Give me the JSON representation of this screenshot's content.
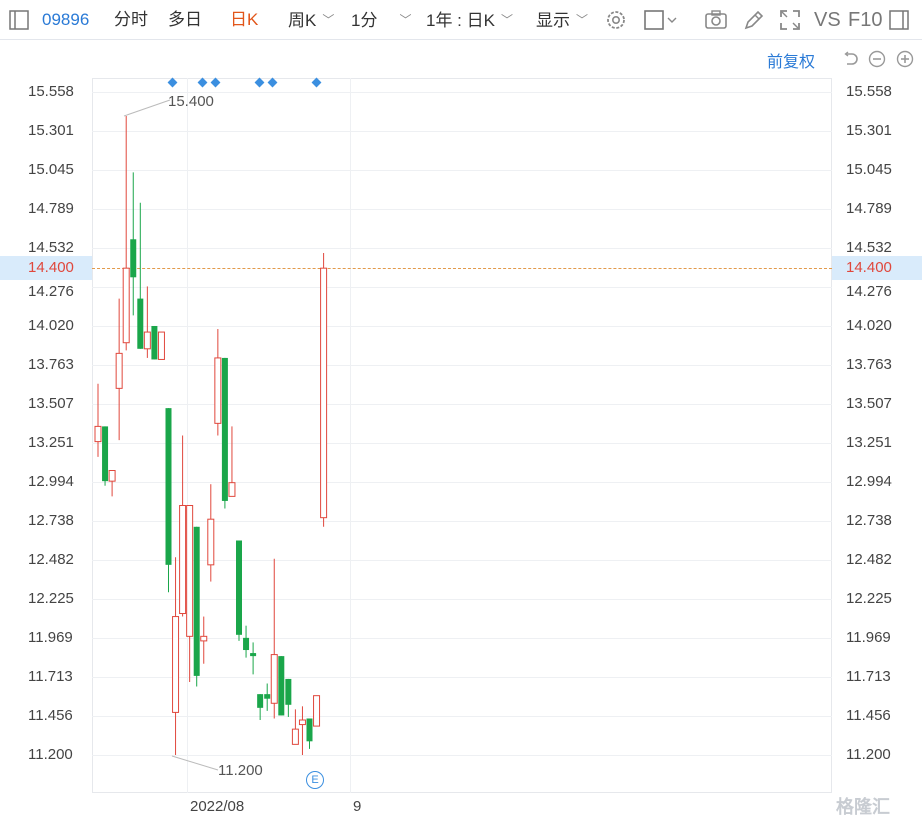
{
  "toolbar": {
    "code": "09896",
    "tab_intraday": "分时",
    "tab_multiday": "多日",
    "tab_daily": "日K",
    "tab_weekly": "周K",
    "tab_minute": "1分",
    "range": "1年 : 日K",
    "display": "显示",
    "vs": "VS",
    "f10": "F10"
  },
  "subbar": {
    "restore": "前复权"
  },
  "chart_data": {
    "type": "candlestick",
    "yticks": [
      "15.558",
      "15.301",
      "15.045",
      "14.789",
      "14.532",
      "14.276",
      "14.020",
      "13.763",
      "13.507",
      "13.251",
      "12.994",
      "12.738",
      "12.482",
      "12.225",
      "11.969",
      "11.713",
      "11.456",
      "11.200"
    ],
    "current_price": "14.400",
    "xlabels": [
      "2022/08",
      "9"
    ],
    "annotations": {
      "high": "15.400",
      "low": "11.200"
    },
    "event_marker": "E",
    "colors": {
      "up": "#e0473c",
      "down": "#1aa64a"
    },
    "candles": [
      {
        "o": 13.26,
        "c": 13.36,
        "h": 13.64,
        "l": 13.16
      },
      {
        "o": 13.36,
        "c": 13.0,
        "h": 13.36,
        "l": 12.97
      },
      {
        "o": 13.0,
        "c": 13.07,
        "h": 13.07,
        "l": 12.9
      },
      {
        "o": 13.61,
        "c": 13.84,
        "h": 14.2,
        "l": 13.27
      },
      {
        "o": 13.91,
        "c": 14.4,
        "h": 15.4,
        "l": 13.86
      },
      {
        "o": 14.59,
        "c": 14.34,
        "h": 15.03,
        "l": 14.09
      },
      {
        "o": 14.2,
        "c": 13.87,
        "h": 14.83,
        "l": 13.87
      },
      {
        "o": 13.87,
        "c": 13.98,
        "h": 14.28,
        "l": 13.81
      },
      {
        "o": 14.02,
        "c": 13.8,
        "h": 14.02,
        "l": 13.8
      },
      {
        "o": 13.8,
        "c": 13.98,
        "h": 13.98,
        "l": 13.8
      },
      {
        "o": 13.48,
        "c": 12.45,
        "h": 13.48,
        "l": 12.27
      },
      {
        "o": 11.48,
        "c": 12.11,
        "h": 12.5,
        "l": 11.2
      },
      {
        "o": 12.13,
        "c": 12.84,
        "h": 13.3,
        "l": 12.11
      },
      {
        "o": 11.98,
        "c": 12.84,
        "h": 12.84,
        "l": 11.68
      },
      {
        "o": 12.7,
        "c": 11.72,
        "h": 12.7,
        "l": 11.65
      },
      {
        "o": 11.95,
        "c": 11.98,
        "h": 12.11,
        "l": 11.8
      },
      {
        "o": 12.45,
        "c": 12.75,
        "h": 12.98,
        "l": 12.34
      },
      {
        "o": 13.38,
        "c": 13.81,
        "h": 14.0,
        "l": 13.3
      },
      {
        "o": 13.81,
        "c": 12.87,
        "h": 13.81,
        "l": 12.82
      },
      {
        "o": 12.9,
        "c": 12.99,
        "h": 13.36,
        "l": 12.9
      },
      {
        "o": 12.61,
        "c": 11.99,
        "h": 12.61,
        "l": 11.95
      },
      {
        "o": 11.97,
        "c": 11.89,
        "h": 12.05,
        "l": 11.84
      },
      {
        "o": 11.87,
        "c": 11.85,
        "h": 11.94,
        "l": 11.73
      },
      {
        "o": 11.6,
        "c": 11.51,
        "h": 11.6,
        "l": 11.43
      },
      {
        "o": 11.6,
        "c": 11.57,
        "h": 11.67,
        "l": 11.49
      },
      {
        "o": 11.54,
        "c": 11.86,
        "h": 12.49,
        "l": 11.44
      },
      {
        "o": 11.85,
        "c": 11.46,
        "h": 11.85,
        "l": 11.46
      },
      {
        "o": 11.7,
        "c": 11.53,
        "h": 11.7,
        "l": 11.45
      },
      {
        "o": 11.27,
        "c": 11.37,
        "h": 11.5,
        "l": 11.27
      },
      {
        "o": 11.4,
        "c": 11.43,
        "h": 11.52,
        "l": 11.2
      },
      {
        "o": 11.44,
        "c": 11.29,
        "h": 11.44,
        "l": 11.24
      },
      {
        "o": 11.39,
        "c": 11.59,
        "h": 11.59,
        "l": 11.39
      },
      {
        "o": 12.76,
        "c": 14.4,
        "h": 14.5,
        "l": 12.7
      }
    ]
  },
  "watermark": "格隆汇"
}
